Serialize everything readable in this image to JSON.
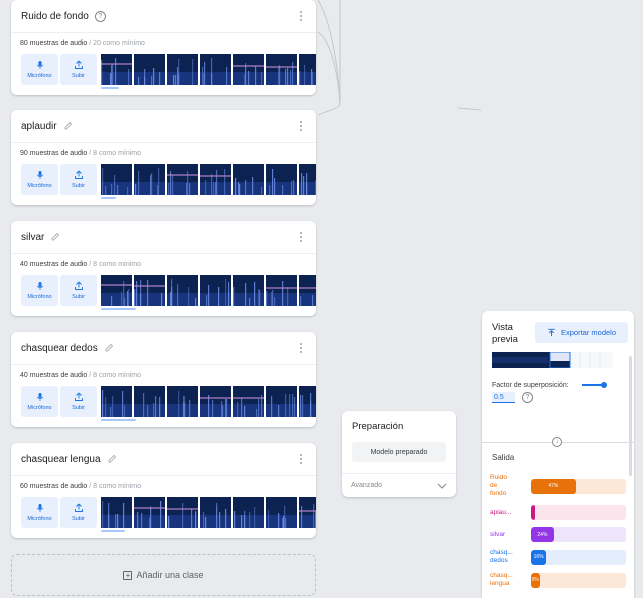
{
  "classes": [
    {
      "title": "Ruido de fondo",
      "title_icon": "help-icon",
      "count": "80 muestras de audio",
      "minimum": "/ 20 como mínimo"
    },
    {
      "title": "aplaudir",
      "title_icon": "pencil-icon",
      "count": "90 muestras de audio",
      "minimum": "/ 8 como mínimo"
    },
    {
      "title": "silvar",
      "title_icon": "pencil-icon",
      "count": "40 muestras de audio",
      "minimum": "/ 8 como mínimo"
    },
    {
      "title": "chasquear dedos",
      "title_icon": "pencil-icon",
      "count": "40 muestras de audio",
      "minimum": "/ 8 como mínimo"
    },
    {
      "title": "chasquear lengua",
      "title_icon": "pencil-icon",
      "count": "60 muestras de audio",
      "minimum": "/ 8 como mínimo"
    }
  ],
  "source_buttons": {
    "microphone": "Micrófono",
    "upload": "Subir"
  },
  "add_class": "Añadir una clase",
  "training": {
    "title": "Preparación",
    "button": "Modelo preparado",
    "advanced": "Avanzado"
  },
  "preview": {
    "title_line1": "Vista",
    "title_line2": "previa",
    "export_button": "Exportar modelo",
    "overlap_label": "Factor de superposición:",
    "overlap_value": "0.5",
    "overlap_fraction": 0.5,
    "output_label": "Salida",
    "outputs": [
      {
        "label_line1": "Ruido",
        "label_line2": "de",
        "label_line3": "fondo",
        "percent_text": "47%",
        "fraction": 0.47,
        "color": "#e8710a",
        "track": "#fde8d8"
      },
      {
        "label_line1": "aplau...",
        "label_line2": "",
        "label_line3": "",
        "percent_text": "",
        "fraction": 0.04,
        "color": "#d01884",
        "track": "#fce4ec"
      },
      {
        "label_line1": "silvar",
        "label_line2": "",
        "label_line3": "",
        "percent_text": "24%",
        "fraction": 0.24,
        "color": "#9334e6",
        "track": "#efe5fb"
      },
      {
        "label_line1": "chasq...",
        "label_line2": "dedos",
        "label_line3": "",
        "percent_text": "16%",
        "fraction": 0.16,
        "color": "#1a73e8",
        "track": "#e3edfc"
      },
      {
        "label_line1": "chasq...",
        "label_line2": "lengua",
        "label_line3": "",
        "percent_text": "9%",
        "fraction": 0.09,
        "color": "#e8710a",
        "track": "#fde8d8"
      }
    ]
  },
  "colors": {
    "accent": "#1a73e8",
    "spectrogram_dark": "#0c2250",
    "spectrogram_light": "#4a6fd8"
  }
}
